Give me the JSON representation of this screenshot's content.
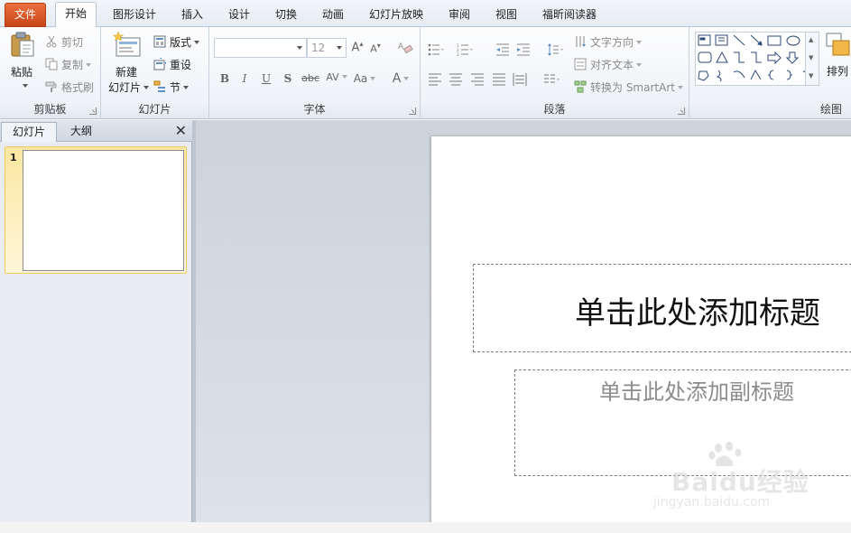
{
  "tabs": [
    "文件",
    "开始",
    "图形设计",
    "插入",
    "设计",
    "切换",
    "动画",
    "幻灯片放映",
    "审阅",
    "视图",
    "福昕阅读器"
  ],
  "clipboard": {
    "label": "剪贴板",
    "paste": "粘贴",
    "cut": "剪切",
    "copy": "复制",
    "format_painter": "格式刷"
  },
  "slides_group": {
    "label": "幻灯片",
    "new_slide_line1": "新建",
    "new_slide_line2": "幻灯片",
    "layout": "版式",
    "reset": "重设",
    "section": "节"
  },
  "font_group": {
    "label": "字体",
    "font_name": "",
    "font_size": "12",
    "bold": "B",
    "italic": "I",
    "underline": "U",
    "shadow": "S",
    "strike": "abc",
    "spacing": "AV",
    "case": "Aa",
    "color": "A",
    "grow": "A",
    "shrink": "A"
  },
  "paragraph_group": {
    "label": "段落",
    "text_direction": "文字方向",
    "align_text": "对齐文本",
    "smartart": "转换为 SmartArt"
  },
  "drawing_group": {
    "label": "绘图",
    "arrange": "排列"
  },
  "left_panel": {
    "tab_slides": "幻灯片",
    "tab_outline": "大纲",
    "close": "✕",
    "slide_number": "1"
  },
  "slide": {
    "title_placeholder": "单击此处添加标题",
    "subtitle_placeholder": "单击此处添加副标题"
  },
  "watermark": {
    "brand": "Baidu经验",
    "url": "jingyan.baidu.com"
  },
  "colors": {
    "file_tab": "#d2532a",
    "accent": "#2b579a"
  }
}
